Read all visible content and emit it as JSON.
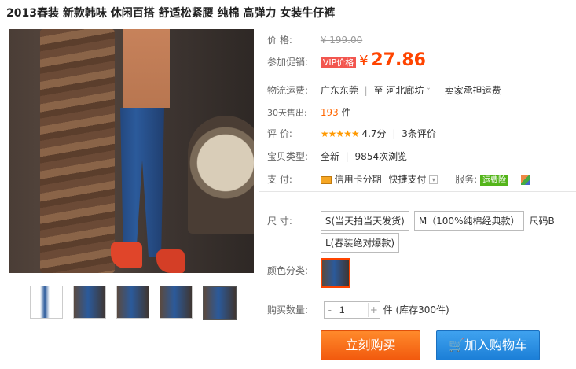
{
  "title": "2013春装 新款韩味 休闲百搭 舒适松紧腰 纯棉 高弹力 女装牛仔裤",
  "price": {
    "label": "价    格:",
    "original": "¥ 199.00"
  },
  "promo": {
    "label": "参加促销:",
    "tag": "VIP价格",
    "currency": "¥",
    "value": "27.86"
  },
  "shipping": {
    "label": "物流运费:",
    "from": "广东东莞",
    "to_prefix": "至",
    "to": "河北廊坊",
    "note": "卖家承担运费"
  },
  "sold": {
    "label": "30天售出:",
    "count": "193",
    "unit": "件"
  },
  "rating": {
    "label": "评    价:",
    "stars": "★★★★★",
    "score": "4.7分",
    "reviews": "3条评价"
  },
  "type": {
    "label": "宝贝类型:",
    "value": "全新",
    "views": "9854次浏览"
  },
  "payment": {
    "label": "支    付:",
    "credit": "信用卡分期",
    "quick": "快捷支付",
    "service_label": "服务:",
    "service_badge": "运费险"
  },
  "size": {
    "label": "尺    寸:",
    "options": [
      "S(当天拍当天发货)",
      "M（100%纯棉经典款）",
      "L(春装绝对爆款)"
    ],
    "more": "尺码B"
  },
  "color": {
    "label": "颜色分类:"
  },
  "quantity": {
    "label": "购买数量:",
    "value": "1",
    "minus": "-",
    "plus": "+",
    "suffix": "件 (库存300件)"
  },
  "buttons": {
    "buy": "立刻购买",
    "cart": "加入购物车"
  },
  "colors": {
    "price": "#ff4400",
    "buy_button": "#f25a0e",
    "cart_button": "#1c7fd7"
  }
}
